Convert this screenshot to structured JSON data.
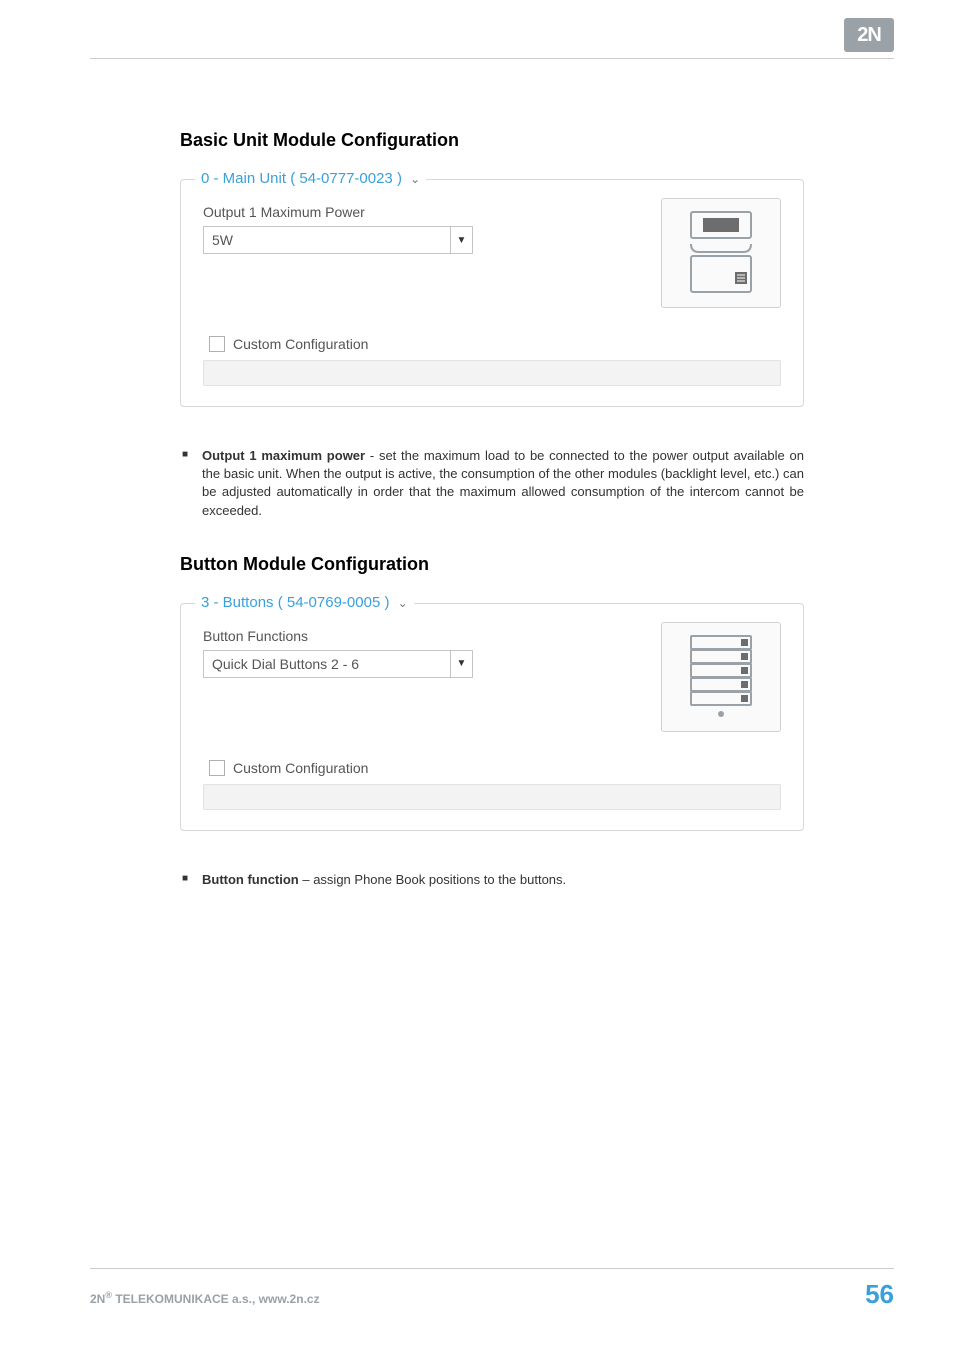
{
  "logo": "2N",
  "section1": {
    "title": "Basic Unit Module Configuration",
    "legend": "0 - Main Unit ( 54-0777-0023 )",
    "field_label": "Output 1 Maximum Power",
    "field_value": "5W",
    "checkbox_label": "Custom Configuration",
    "bullet_bold": "Output 1 maximum power",
    "bullet_text": " - set the maximum load to be connected to the power output available on the basic unit. When the output is active, the consumption of the other modules (backlight level, etc.) can be adjusted automatically in order that the maximum allowed consumption of the intercom cannot be exceeded."
  },
  "section2": {
    "title": "Button Module Configuration",
    "legend": "3 - Buttons ( 54-0769-0005 )",
    "field_label": "Button Functions",
    "field_value": "Quick Dial Buttons 2 - 6",
    "checkbox_label": "Custom Configuration",
    "bullet_bold": "Button function",
    "bullet_text": " – assign Phone Book positions to the buttons."
  },
  "footer": {
    "company": "2N",
    "reg": "®",
    "rest": " TELEKOMUNIKACE a.s., www.2n.cz",
    "page": "56"
  }
}
